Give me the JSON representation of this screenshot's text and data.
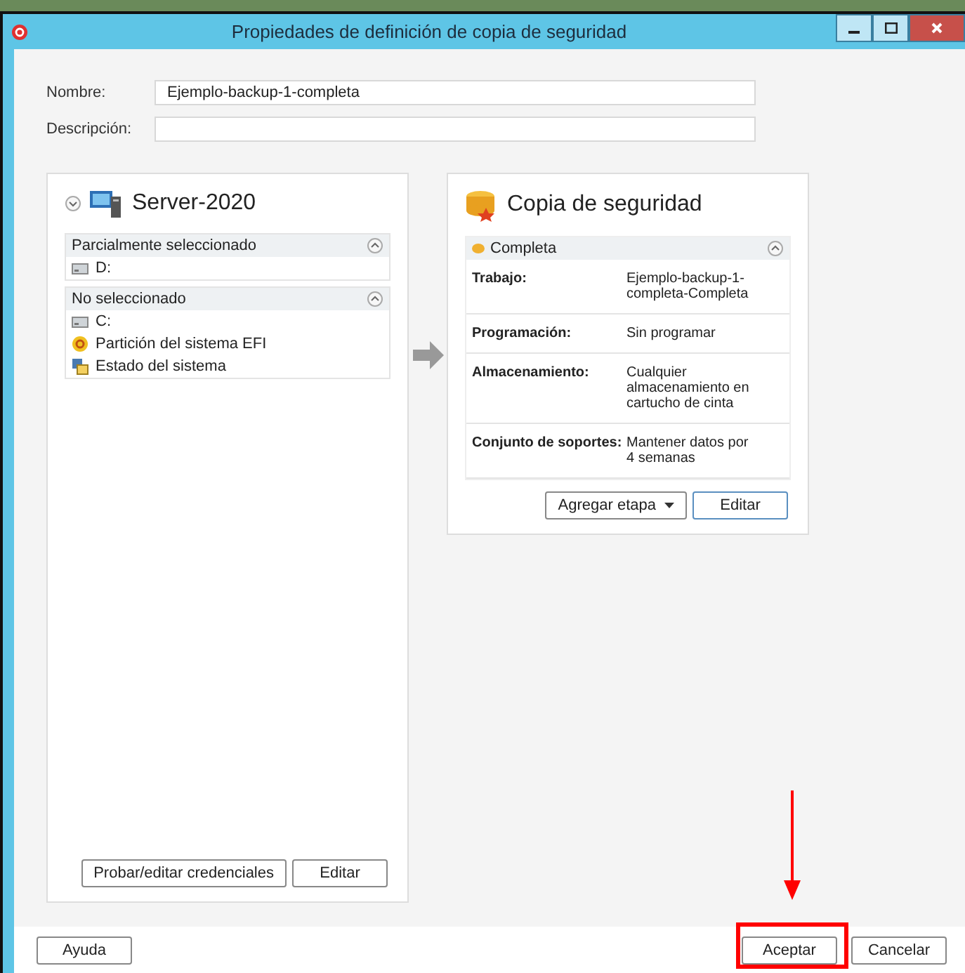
{
  "window": {
    "title": "Propiedades de definición de copia de seguridad"
  },
  "fields": [
    {
      "label": "Nombre:",
      "value": "Ejemplo-backup-1-completa"
    },
    {
      "label": "Descripción:"
    }
  ],
  "source": {
    "title": "Server-2020",
    "groups": [
      {
        "title": "Parcialmente seleccionado",
        "expanded": true,
        "items": [
          {
            "kind": "drive",
            "label": "D:"
          }
        ]
      },
      {
        "title": "No seleccionado",
        "expanded": true,
        "items": [
          {
            "kind": "drive",
            "label": "C:"
          },
          {
            "kind": "efi",
            "label": "Partición del sistema EFI"
          },
          {
            "kind": "system",
            "label": "Estado del sistema"
          }
        ]
      }
    ],
    "buttons": [
      "Probar/editar credenciales",
      "Editar"
    ]
  },
  "stage": {
    "title": "Copia de seguridad",
    "section": "Completa",
    "expanded": true,
    "rows": [
      {
        "label": "Trabajo:",
        "value": "Ejemplo-backup-1-completa-Completa"
      },
      {
        "label": "Programación:",
        "value": "Sin programar"
      },
      {
        "label": "Almacenamiento:",
        "value": "Cualquier almacenamiento en cartucho de cinta"
      },
      {
        "label": "Conjunto de soportes:",
        "value": "Mantener datos por 4 semanas"
      }
    ],
    "add_button": "Agregar etapa",
    "edit_button": "Editar"
  },
  "footer": {
    "help": "Ayuda",
    "ok": "Aceptar",
    "cancel": "Cancelar"
  }
}
